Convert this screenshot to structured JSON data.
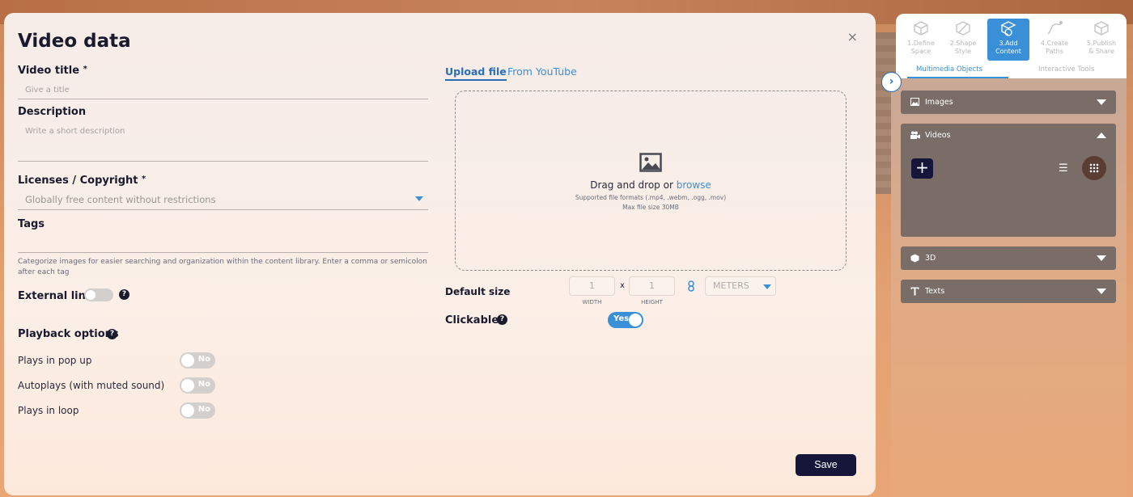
{
  "modal": {
    "title": "Video data",
    "close": "×",
    "video_title": {
      "label": "Video title",
      "required_mark": "*",
      "placeholder": "Give a title"
    },
    "description": {
      "label": "Description",
      "placeholder": "Write a short description"
    },
    "licenses": {
      "label": "Licenses / Copyright",
      "required_mark": "*",
      "value": "Globally free content without restrictions"
    },
    "tags": {
      "label": "Tags",
      "help": "Categorize images for easier searching and organization within the content library. Enter a comma or semicolon after each tag"
    },
    "external_link": {
      "label": "External link",
      "on": false
    },
    "playback": {
      "label": "Playback options",
      "options": [
        {
          "label": "Plays in pop up",
          "state": "No"
        },
        {
          "label": "Autoplays (with muted sound)",
          "state": "No"
        },
        {
          "label": "Plays in loop",
          "state": "No"
        }
      ]
    },
    "tabs": {
      "upload": "Upload file",
      "youtube": "From YouTube"
    },
    "dropzone": {
      "main": "Drag and drop or ",
      "browse": "browse",
      "formats": "Supported file formats (.mp4, .webm, .ogg, .mov)",
      "max_size": "Max file size 30MB"
    },
    "default_size": {
      "label": "Default size",
      "width": "1",
      "height": "1",
      "times": "x",
      "width_caption": "WIDTH",
      "height_caption": "HEIGHT",
      "units": "METERS"
    },
    "clickable": {
      "label": "Clickable",
      "state": "Yes"
    },
    "help_glyph": "?",
    "save": "Save"
  },
  "panel": {
    "collapse": "›",
    "steps": [
      {
        "line1": "1.Define",
        "line2": "Space"
      },
      {
        "line1": "2.Shape",
        "line2": "Style"
      },
      {
        "line1": "3.Add",
        "line2": "Content"
      },
      {
        "line1": "4.Create",
        "line2": "Paths"
      },
      {
        "line1": "5.Publish",
        "line2": "& Share"
      }
    ],
    "active_step": 2,
    "subtabs": {
      "multimedia": "Multimedia Objects",
      "interactive": "Interactive Tools"
    },
    "sections": {
      "images": "Images",
      "videos": "Videos",
      "three_d": "3D",
      "texts": "Texts"
    },
    "add": "+",
    "list_glyph": "☰"
  },
  "colors": {
    "accent": "#3a8fd9",
    "dark": "#16163a",
    "accordion": "#7a6d67"
  }
}
